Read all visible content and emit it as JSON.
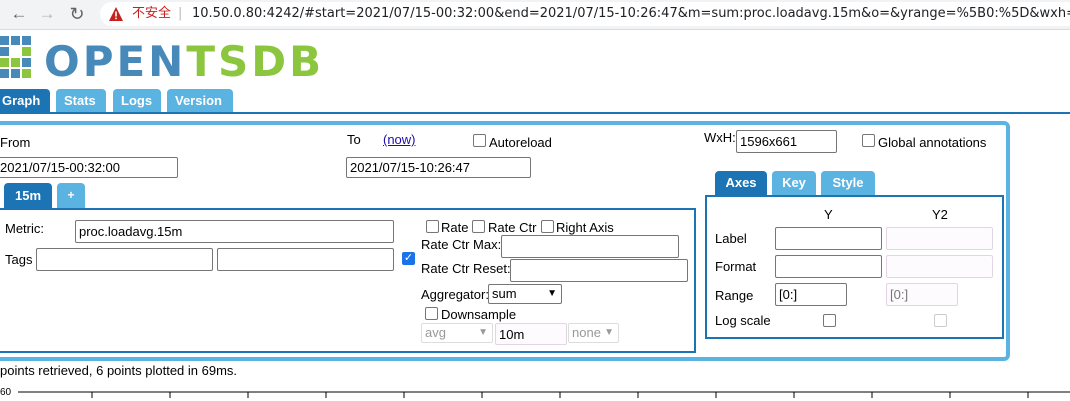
{
  "browser": {
    "insecure_label": "不安全",
    "separator": "|",
    "url": "10.50.0.80:4242/#start=2021/07/15-00:32:00&end=2021/07/15-10:26:47&m=sum:proc.loadavg.15m&o=&yrange=%5B0:%5D&wxh="
  },
  "logo": {
    "part1": "OPEN",
    "part2": "TSDB",
    "color1": "#4789b8",
    "color2": "#8cc63f"
  },
  "tabs": [
    {
      "label": "Graph",
      "active": true
    },
    {
      "label": "Stats",
      "active": false
    },
    {
      "label": "Logs",
      "active": false
    },
    {
      "label": "Version",
      "active": false
    }
  ],
  "time": {
    "from_label": "From",
    "to_label": "To",
    "now_link": "(now)",
    "autoreload_label": "Autoreload",
    "from_value": "2021/07/15-00:32:00",
    "to_value": "2021/07/15-10:26:47"
  },
  "size": {
    "wxh_label": "WxH:",
    "wxh_value": "1596x661",
    "global_annotations_label": "Global annotations"
  },
  "metric_tabs": [
    {
      "label": "15m"
    },
    {
      "label": "+"
    }
  ],
  "metric": {
    "metric_label": "Metric:",
    "metric_value": "proc.loadavg.15m",
    "tags_label": "Tags",
    "tag_key": "",
    "tag_value": "",
    "tag_checked": true,
    "rate_label": "Rate",
    "rate_ctr_label": "Rate Ctr",
    "right_axis_label": "Right Axis",
    "rate_ctr_max_label": "Rate Ctr Max:",
    "rate_ctr_max_value": "",
    "rate_ctr_reset_label": "Rate Ctr Reset:",
    "rate_ctr_reset_value": "",
    "aggregator_label": "Aggregator:",
    "aggregator_value": "sum",
    "downsample_label": "Downsample",
    "downsample_func": "avg",
    "downsample_interval": "10m",
    "downsample_fill": "none"
  },
  "axes_tabs": [
    {
      "label": "Axes",
      "active": true
    },
    {
      "label": "Key",
      "active": false
    },
    {
      "label": "Style",
      "active": false
    }
  ],
  "axes": {
    "y_header": "Y",
    "y2_header": "Y2",
    "label_row": "Label",
    "format_row": "Format",
    "range_row": "Range",
    "logscale_row": "Log scale",
    "y_range": "[0:]",
    "y2_range": "[0:]"
  },
  "status": "points retrieved, 6 points plotted in 69ms.",
  "chart": {
    "y_tick_top": "60"
  },
  "colors": {
    "tab_active": "#1c74b4",
    "tab_inactive": "#5bb3e1",
    "panel_border": "#5bb3e1"
  }
}
